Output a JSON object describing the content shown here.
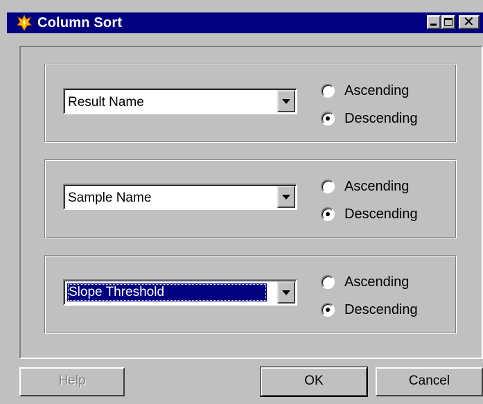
{
  "window": {
    "title": "Column Sort",
    "icon": "flame-app-icon",
    "controls": [
      "minimize-icon",
      "maximize-icon",
      "close-icon"
    ]
  },
  "sort_groups": [
    {
      "column": "Result Name",
      "ascending_label": "Ascending",
      "descending_label": "Descending",
      "selected_order": "Descending",
      "focused": false
    },
    {
      "column": "Sample Name",
      "ascending_label": "Ascending",
      "descending_label": "Descending",
      "selected_order": "Descending",
      "focused": false
    },
    {
      "column": "Slope Threshold",
      "ascending_label": "Ascending",
      "descending_label": "Descending",
      "selected_order": "Descending",
      "focused": true
    }
  ],
  "buttons": {
    "help": "Help",
    "ok": "OK",
    "cancel": "Cancel"
  },
  "colors": {
    "titlebar": "#000080",
    "face": "#c0c0c0",
    "selection": "#000080"
  }
}
